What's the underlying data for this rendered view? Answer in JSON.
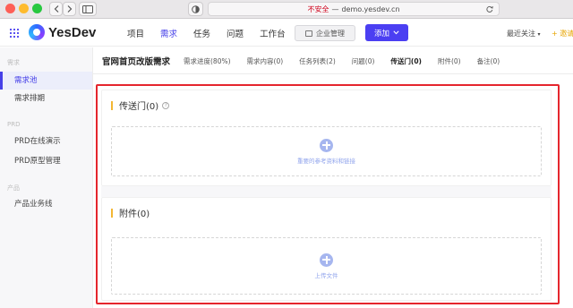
{
  "browser": {
    "security_label": "不安全",
    "separator": "—",
    "url": "demo.yesdev.cn"
  },
  "header": {
    "brand": "YesDev",
    "nav": [
      "项目",
      "需求",
      "任务",
      "问题",
      "工作台"
    ],
    "active_nav": "需求",
    "enterprise_label": "企业管理",
    "add_label": "添加",
    "recent_label": "最近关注",
    "invite_label": "邀请"
  },
  "sidebar": {
    "section_demand": "需求",
    "items_demand": [
      "需求池",
      "需求排期"
    ],
    "section_prd": "PRD",
    "items_prd": [
      "PRD在线演示",
      "PRD原型管理"
    ],
    "section_product": "产品",
    "items_product": [
      "产品业务线"
    ]
  },
  "page": {
    "title": "官网首页改版需求",
    "tabs": [
      "需求进度(80%)",
      "需求内容(0)",
      "任务列表(2)",
      "问题(0)",
      "传送门(0)",
      "附件(0)",
      "备注(0)"
    ],
    "active_tab": "传送门(0)"
  },
  "portal_panel": {
    "title": "传送门(0)",
    "help": "?",
    "dropzone_label": "重要的参考资料和链接"
  },
  "attachment_panel": {
    "title": "附件(0)",
    "dropzone_label": "上传文件"
  },
  "colors": {
    "accent": "#4640e8",
    "highlight_frame": "#e5262d",
    "section_bar": "#f3b633"
  }
}
